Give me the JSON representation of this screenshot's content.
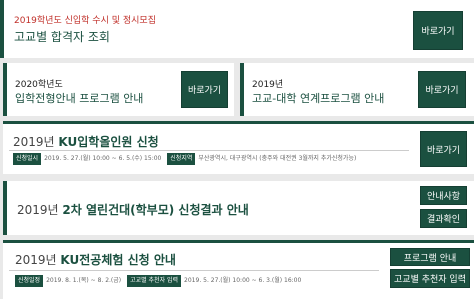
{
  "card1": {
    "subtitle": "2019학년도 신입학 수시 및 정시모집",
    "title": "고교별 합격자 조회",
    "button": "바로가기",
    "subtitle_color": "#c0302a"
  },
  "card2": {
    "subtitle": "2020학년도",
    "title": "입학전형안내 프로그램 안내",
    "button": "바로가기"
  },
  "card3": {
    "subtitle": "2019년",
    "title": "고교-대학 연계프로그램 안내",
    "button": "바로가기"
  },
  "card4": {
    "year": "2019년",
    "title": "KU입학올인원 신청",
    "button": "바로가기",
    "tag1": "신청일시",
    "period": "2019. 5. 27.(월) 10:00 ~ 6. 5.(수) 15:00",
    "tag2": "신청지역",
    "region": "부산광역시, 대구광역시 (충주와 대전권 3월까지 추가신청가능)"
  },
  "card5": {
    "year": "2019년",
    "title": "2차 열린건대(학부모) 신청결과 안내",
    "button1": "안내사항",
    "button2": "결과확인"
  },
  "card6": {
    "year": "2019년",
    "title": "KU전공체험 신청 안내",
    "button1": "프로그램 안내",
    "button2": "고교별 추천자 입력",
    "tag1": "신청일정",
    "period1": "2019. 8. 1.(목) ~ 8. 2.(금)",
    "tag2": "고교별 추천자 입력",
    "period2": "2019. 5. 27.(월) 10:00 ~ 6. 3.(월) 16:00"
  },
  "colors": {
    "accent": "#1b5040",
    "background": "#e9e9e9"
  }
}
